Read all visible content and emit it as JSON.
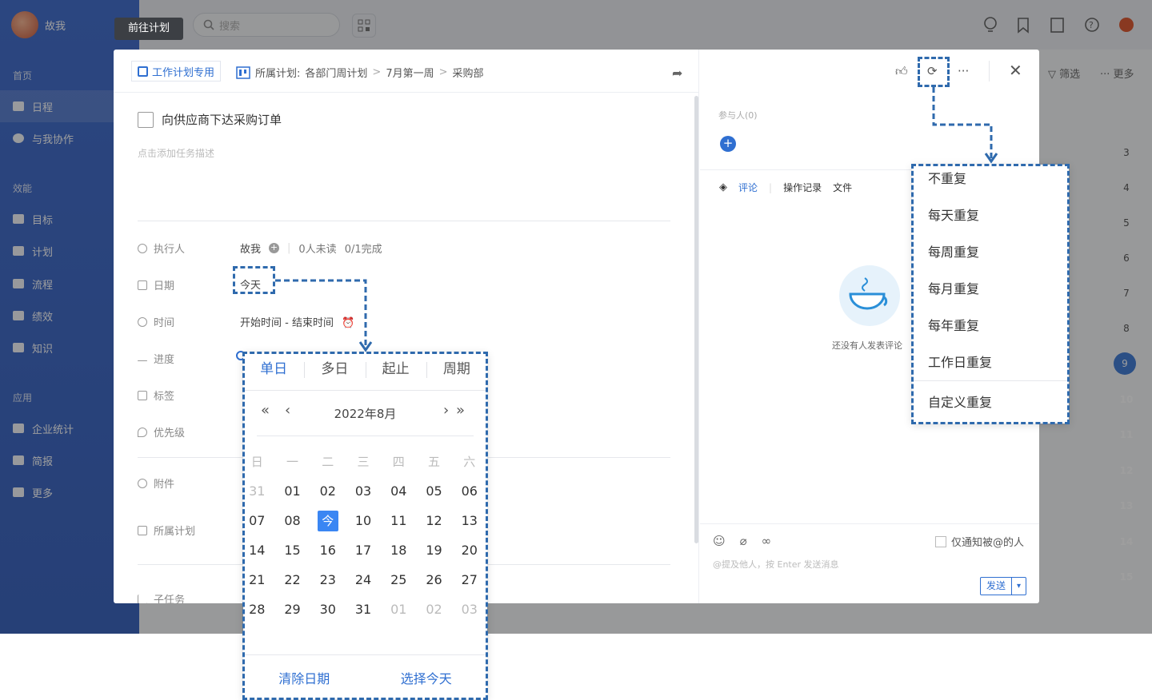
{
  "sidebar": {
    "user": "故我",
    "group_home": "首页",
    "items_main": [
      {
        "label": "日程",
        "icon": "calendar-icon",
        "active": true
      },
      {
        "label": "与我协作",
        "icon": "compass-icon",
        "active": false
      }
    ],
    "group_efficiency": "效能",
    "items_efficiency": [
      {
        "label": "目标",
        "icon": "flag-icon"
      },
      {
        "label": "计划",
        "icon": "clipboard-icon"
      },
      {
        "label": "流程",
        "icon": "cube-icon"
      },
      {
        "label": "绩效",
        "icon": "chart-icon"
      },
      {
        "label": "知识",
        "icon": "book-icon"
      }
    ],
    "group_apps": "应用",
    "items_apps": [
      {
        "label": "企业统计",
        "icon": "monitor-icon"
      },
      {
        "label": "简报",
        "icon": "report-icon"
      },
      {
        "label": "更多",
        "icon": "grid-icon"
      }
    ]
  },
  "topbar": {
    "goto_button": "前往计划",
    "search_placeholder": "搜索",
    "filter_label": "筛选",
    "more_label": "更多"
  },
  "strip": {
    "days": [
      "3",
      "4",
      "5",
      "6",
      "7",
      "8",
      "9",
      "10",
      "11",
      "12",
      "13",
      "14",
      "15"
    ],
    "today": "9"
  },
  "modal": {
    "tag_label": "工作计划专用",
    "breadcrumb_prefix": "所属计划:",
    "breadcrumb": [
      "各部门周计划",
      "7月第一周",
      "采购部"
    ],
    "task_title": "向供应商下达采购订单",
    "description_placeholder": "点击添加任务描述",
    "fields": {
      "executor_label": "执行人",
      "executor_value": "故我",
      "read_status": "0人未读",
      "completion": "0/1完成",
      "date_label": "日期",
      "date_value": "今天",
      "time_label": "时间",
      "time_value": "开始时间 - 结束时间",
      "progress_label": "进度",
      "tag_label": "标签",
      "priority_label": "优先级",
      "attachment_label": "附件",
      "plan_label": "所属计划",
      "subtask_label": "子任务"
    }
  },
  "right_panel": {
    "participants": "参与人(0)",
    "tabs": [
      {
        "label": "评论",
        "active": true
      },
      {
        "label": "操作记录",
        "active": false
      },
      {
        "label": "文件",
        "active": false
      }
    ],
    "empty_text": "还没有人发表评论",
    "notify_only_mentioned": "仅通知被@的人",
    "input_placeholder": "@提及他人，按 Enter 发送消息",
    "send_label": "发送"
  },
  "date_picker": {
    "tabs": [
      {
        "label": "单日",
        "active": true
      },
      {
        "label": "多日",
        "active": false
      },
      {
        "label": "起止",
        "active": false
      },
      {
        "label": "周期",
        "active": false
      }
    ],
    "month_label": "2022年8月",
    "weekdays": [
      "日",
      "一",
      "二",
      "三",
      "四",
      "五",
      "六"
    ],
    "weeks": [
      [
        "31",
        "01",
        "02",
        "03",
        "04",
        "05",
        "06"
      ],
      [
        "07",
        "08",
        "今",
        "10",
        "11",
        "12",
        "13"
      ],
      [
        "14",
        "15",
        "16",
        "17",
        "18",
        "19",
        "20"
      ],
      [
        "21",
        "22",
        "23",
        "24",
        "25",
        "26",
        "27"
      ],
      [
        "28",
        "29",
        "30",
        "31",
        "01",
        "02",
        "03"
      ]
    ],
    "clear_label": "清除日期",
    "today_label": "选择今天"
  },
  "repeat_menu": {
    "items": [
      "不重复",
      "每天重复",
      "每周重复",
      "每月重复",
      "每年重复",
      "工作日重复",
      "自定义重复"
    ]
  },
  "colors": {
    "accent": "#2f6fd1",
    "sidebar": "#2f5fc8",
    "annotation": "#2f6aad"
  }
}
